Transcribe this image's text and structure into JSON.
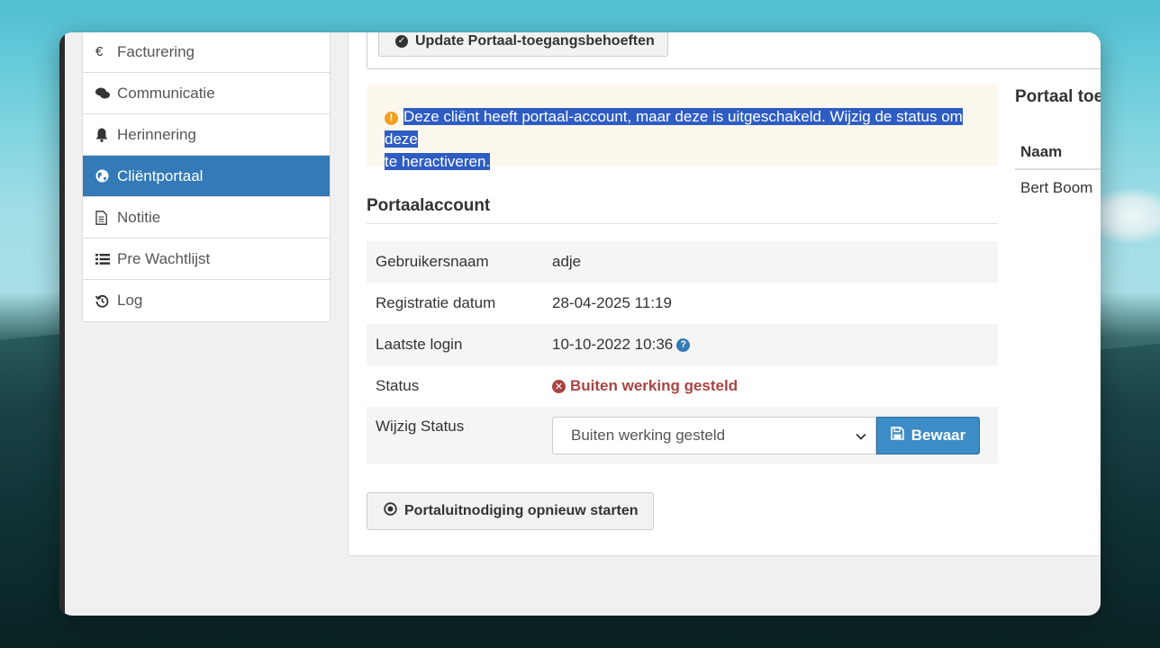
{
  "sidebar": {
    "items": [
      {
        "label": "Facturering",
        "icon": "euro-icon",
        "glyph": "€",
        "active": false
      },
      {
        "label": "Communicatie",
        "icon": "comments-icon",
        "glyph": "💬",
        "active": false
      },
      {
        "label": "Herinnering",
        "icon": "bell-icon",
        "glyph": "🔔",
        "active": false
      },
      {
        "label": "Cliëntportaal",
        "icon": "globe-icon",
        "glyph": "🌐",
        "active": true
      },
      {
        "label": "Notitie",
        "icon": "document-icon",
        "glyph": "🗎",
        "active": false
      },
      {
        "label": "Pre Wachtlijst",
        "icon": "list-icon",
        "glyph": "☰",
        "active": false
      },
      {
        "label": "Log",
        "icon": "history-icon",
        "glyph": "↺",
        "active": false
      }
    ]
  },
  "main": {
    "update_button": "Update Portaal-toegangsbehoeften",
    "alert_line1": "Deze cliënt heeft portaal-account, maar deze is uitgeschakeld. Wijzig de status om deze",
    "alert_line2": "te heractiveren.",
    "section_title": "Portaalaccount",
    "rows": {
      "username_label": "Gebruikersnaam",
      "username_value": "adje",
      "registration_label": "Registratie datum",
      "registration_value": "28-04-2025 11:19",
      "last_login_label": "Laatste login",
      "last_login_value": "10-10-2022 10:36",
      "status_label": "Status",
      "status_value": "Buiten werking gesteld",
      "change_status_label": "Wijzig Status",
      "change_status_selected": "Buiten werking gesteld",
      "save_button": "Bewaar"
    },
    "restart_button": "Portaluitnodiging opnieuw starten"
  },
  "right_panel": {
    "title": "Portaal toeg",
    "column_header": "Naam",
    "row_value": "Bert Boom"
  },
  "colors": {
    "active_nav": "#337ab7",
    "primary_button": "#3c8cc7",
    "status_danger": "#a94442",
    "alert_bg": "#fcf8ee",
    "selection_highlight": "#2d5cc3",
    "warning": "#f0a020"
  }
}
